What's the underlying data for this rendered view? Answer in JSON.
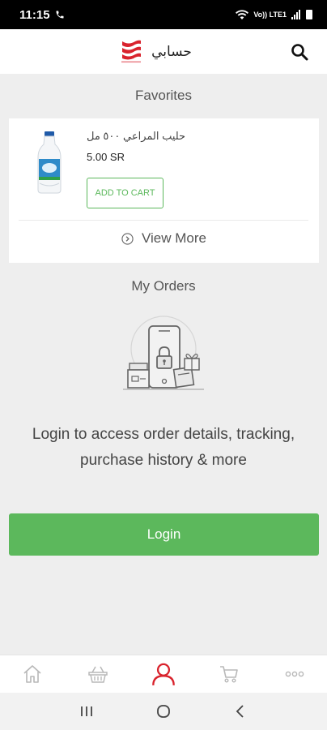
{
  "status_bar": {
    "time": "11:15",
    "signal_text": "Vo)) LTE1",
    "icons": [
      "phone-icon",
      "wifi-icon",
      "signal-icon",
      "battery-icon"
    ]
  },
  "header": {
    "title": "حسابي",
    "logo_icon": "brand-logo",
    "search_icon": "search-icon"
  },
  "favorites": {
    "title": "Favorites",
    "items": [
      {
        "name": "حليب المراعي ٥٠٠ مل",
        "price": "5.00 SR",
        "add_to_cart_label": "ADD TO CART",
        "image_icon": "milk-bottle-icon"
      }
    ],
    "view_more_label": "View More"
  },
  "orders": {
    "title": "My Orders",
    "illustration_icon": "locked-phone-illustration",
    "message": "Login to access order details, tracking, purchase history & more",
    "login_label": "Login"
  },
  "bottom_nav": {
    "items": [
      {
        "id": "home",
        "icon": "home-icon",
        "active": false
      },
      {
        "id": "basket",
        "icon": "basket-icon",
        "active": false
      },
      {
        "id": "account",
        "icon": "user-icon",
        "active": true
      },
      {
        "id": "cart",
        "icon": "cart-icon",
        "active": false
      },
      {
        "id": "more",
        "icon": "more-icon",
        "active": false
      }
    ]
  },
  "colors": {
    "accent_green": "#5cb85c",
    "brand_red": "#d9232d",
    "inactive_icon": "#b8b8b8"
  }
}
